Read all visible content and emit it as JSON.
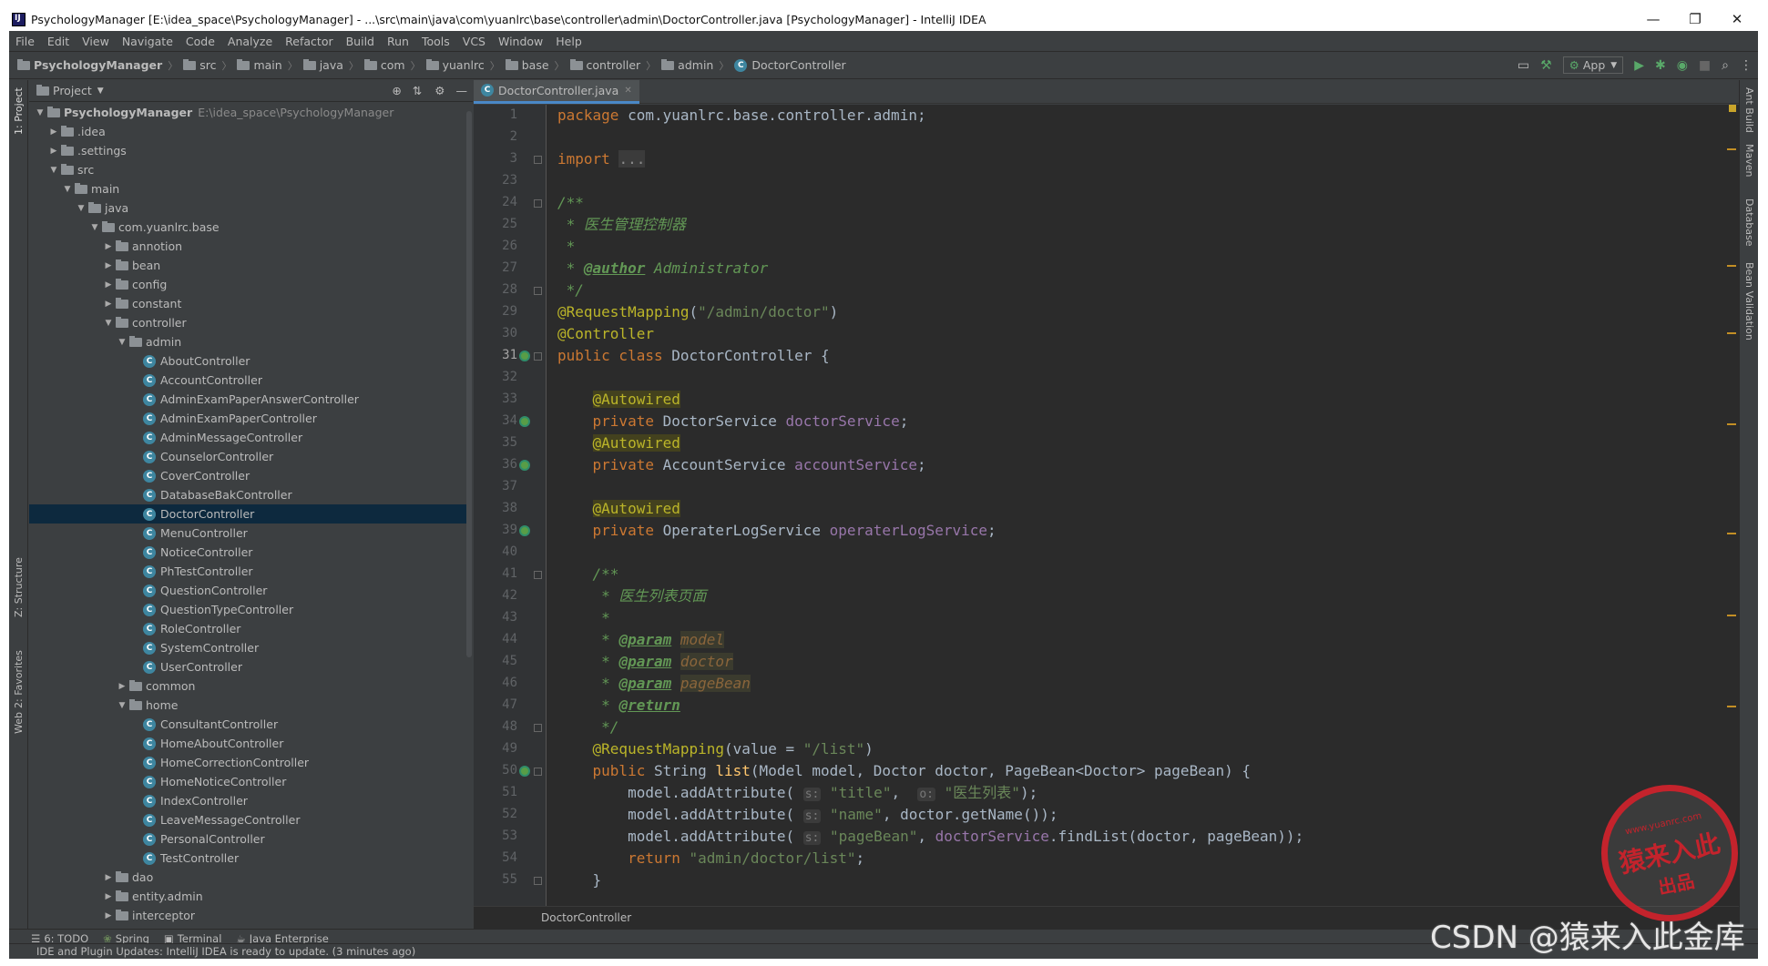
{
  "window": {
    "title": "PsychologyManager [E:\\idea_space\\PsychologyManager] - ...\\src\\main\\java\\com\\yuanlrc\\base\\controller\\admin\\DoctorController.java [PsychologyManager] - IntelliJ IDEA",
    "min": "—",
    "max": "❐",
    "close": "✕"
  },
  "menu": [
    "File",
    "Edit",
    "View",
    "Navigate",
    "Code",
    "Analyze",
    "Refactor",
    "Build",
    "Run",
    "Tools",
    "VCS",
    "Window",
    "Help"
  ],
  "breadcrumbs": [
    "PsychologyManager",
    "src",
    "main",
    "java",
    "com",
    "yuanlrc",
    "base",
    "controller",
    "admin",
    "DoctorController"
  ],
  "toolbar": {
    "run_config": "App"
  },
  "project": {
    "header": "Project",
    "tree": [
      {
        "label": "PsychologyManager",
        "extra": "E:\\idea_space\\PsychologyManager",
        "depth": 0,
        "arrow": "▼",
        "type": "folder"
      },
      {
        "label": ".idea",
        "depth": 1,
        "arrow": "▶",
        "type": "folder"
      },
      {
        "label": ".settings",
        "depth": 1,
        "arrow": "▶",
        "type": "folder"
      },
      {
        "label": "src",
        "depth": 1,
        "arrow": "▼",
        "type": "folder"
      },
      {
        "label": "main",
        "depth": 2,
        "arrow": "▼",
        "type": "folder"
      },
      {
        "label": "java",
        "depth": 3,
        "arrow": "▼",
        "type": "folder"
      },
      {
        "label": "com.yuanlrc.base",
        "depth": 4,
        "arrow": "▼",
        "type": "folder"
      },
      {
        "label": "annotion",
        "depth": 5,
        "arrow": "▶",
        "type": "folder"
      },
      {
        "label": "bean",
        "depth": 5,
        "arrow": "▶",
        "type": "folder"
      },
      {
        "label": "config",
        "depth": 5,
        "arrow": "▶",
        "type": "folder"
      },
      {
        "label": "constant",
        "depth": 5,
        "arrow": "▶",
        "type": "folder"
      },
      {
        "label": "controller",
        "depth": 5,
        "arrow": "▼",
        "type": "folder"
      },
      {
        "label": "admin",
        "depth": 6,
        "arrow": "▼",
        "type": "folder"
      },
      {
        "label": "AboutController",
        "depth": 7,
        "type": "class"
      },
      {
        "label": "AccountController",
        "depth": 7,
        "type": "class"
      },
      {
        "label": "AdminExamPaperAnswerController",
        "depth": 7,
        "type": "class"
      },
      {
        "label": "AdminExamPaperController",
        "depth": 7,
        "type": "class"
      },
      {
        "label": "AdminMessageController",
        "depth": 7,
        "type": "class"
      },
      {
        "label": "CounselorController",
        "depth": 7,
        "type": "class"
      },
      {
        "label": "CoverController",
        "depth": 7,
        "type": "class"
      },
      {
        "label": "DatabaseBakController",
        "depth": 7,
        "type": "class"
      },
      {
        "label": "DoctorController",
        "depth": 7,
        "type": "class",
        "selected": true
      },
      {
        "label": "MenuController",
        "depth": 7,
        "type": "class"
      },
      {
        "label": "NoticeController",
        "depth": 7,
        "type": "class"
      },
      {
        "label": "PhTestController",
        "depth": 7,
        "type": "class"
      },
      {
        "label": "QuestionController",
        "depth": 7,
        "type": "class"
      },
      {
        "label": "QuestionTypeController",
        "depth": 7,
        "type": "class"
      },
      {
        "label": "RoleController",
        "depth": 7,
        "type": "class"
      },
      {
        "label": "SystemController",
        "depth": 7,
        "type": "class"
      },
      {
        "label": "UserController",
        "depth": 7,
        "type": "class"
      },
      {
        "label": "common",
        "depth": 6,
        "arrow": "▶",
        "type": "folder"
      },
      {
        "label": "home",
        "depth": 6,
        "arrow": "▼",
        "type": "folder"
      },
      {
        "label": "ConsultantController",
        "depth": 7,
        "type": "class"
      },
      {
        "label": "HomeAboutController",
        "depth": 7,
        "type": "class"
      },
      {
        "label": "HomeCorrectionController",
        "depth": 7,
        "type": "class"
      },
      {
        "label": "HomeNoticeController",
        "depth": 7,
        "type": "class"
      },
      {
        "label": "IndexController",
        "depth": 7,
        "type": "class"
      },
      {
        "label": "LeaveMessageController",
        "depth": 7,
        "type": "class"
      },
      {
        "label": "PersonalController",
        "depth": 7,
        "type": "class"
      },
      {
        "label": "TestController",
        "depth": 7,
        "type": "class"
      },
      {
        "label": "dao",
        "depth": 5,
        "arrow": "▶",
        "type": "folder"
      },
      {
        "label": "entity.admin",
        "depth": 5,
        "arrow": "▶",
        "type": "folder"
      },
      {
        "label": "interceptor",
        "depth": 5,
        "arrow": "▶",
        "type": "folder"
      }
    ]
  },
  "editor": {
    "tab": "DoctorController.java",
    "line_numbers": [
      "1",
      "2",
      "3",
      "23",
      "24",
      "25",
      "26",
      "27",
      "28",
      "29",
      "30",
      "31",
      "32",
      "33",
      "34",
      "35",
      "36",
      "37",
      "38",
      "39",
      "40",
      "41",
      "42",
      "43",
      "44",
      "45",
      "46",
      "47",
      "48",
      "49",
      "50",
      "51",
      "52",
      "53",
      "54",
      "55"
    ],
    "breadcrumb": "DoctorController"
  },
  "left_tools": [
    "1: Project",
    "Z: Structure",
    "2: Favorites",
    "Web"
  ],
  "right_tools": [
    "Ant Build",
    "Maven",
    "Database",
    "Bean Validation"
  ],
  "bottom_tools": [
    "6: TODO",
    "Spring",
    "Terminal",
    "Java Enterprise"
  ],
  "status": {
    "message": "IDE and Plugin Updates: IntelliJ IDEA is ready to update. (3 minutes ago)"
  },
  "watermark": {
    "csdn": "CSDN @猿来入此金库",
    "stamp_top": "www.yuanrc.com",
    "stamp_main": "猿来入此",
    "stamp_sub": "出品"
  }
}
